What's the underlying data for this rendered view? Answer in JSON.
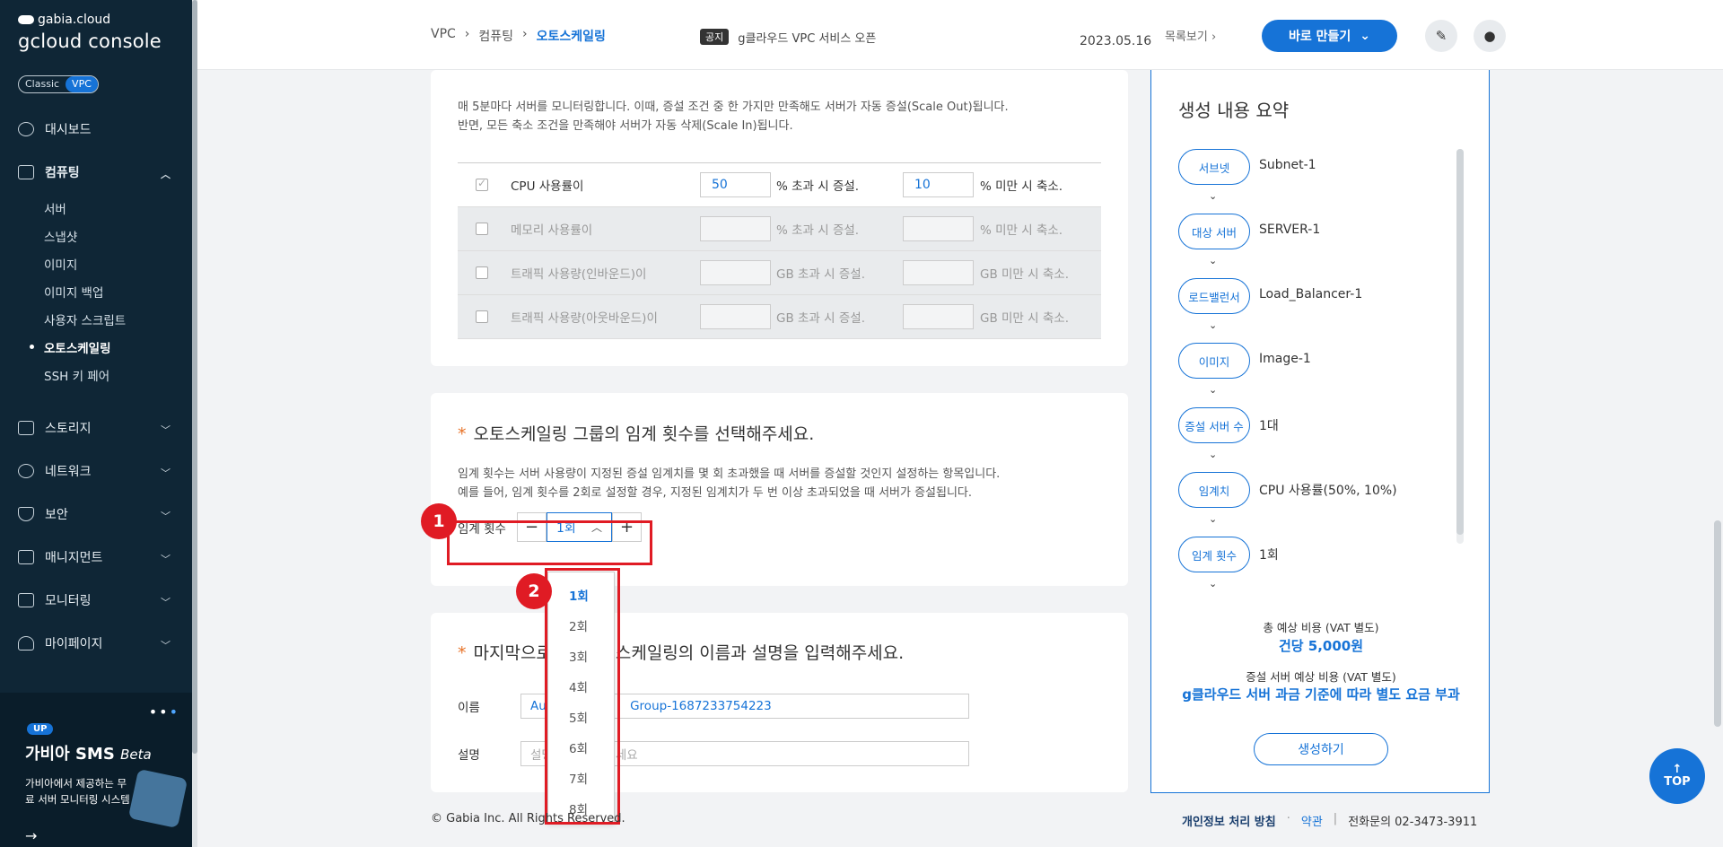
{
  "brand": {
    "small": "gabia.cloud",
    "big": "gcloud console"
  },
  "toggle": {
    "classic": "Classic",
    "vpc": "VPC"
  },
  "nav": {
    "dashboard": "대시보드",
    "computing": "컴퓨팅",
    "computing_sub": [
      "서버",
      "스냅샷",
      "이미지",
      "이미지 백업",
      "사용자 스크립트",
      "오토스케일링",
      "SSH 키 페어"
    ],
    "storage": "스토리지",
    "network": "네트워크",
    "security": "보안",
    "management": "매니지먼트",
    "monitoring": "모니터링",
    "mypage": "마이페이지"
  },
  "promo": {
    "badge": "UP",
    "title": "가비아 SMS",
    "title_beta": "Beta",
    "desc": "가비아에서 제공하는 무료 서버 모니터링 시스템",
    "arrow": "→"
  },
  "breadcrumb": {
    "vpc": "VPC",
    "computing": "컴퓨팅",
    "current": "오토스케일링",
    "sep": "›"
  },
  "notice": {
    "tag": "공지",
    "text": "g클라우드 VPC 서비스 오픈",
    "date": "2023.05.16",
    "more": "목록보기 ›"
  },
  "header": {
    "create_button": "바로 만들기"
  },
  "conditions": {
    "intro_line1": "매 5분마다 서버를 모니터링합니다. 이때, 증설 조건 중 한 가지만 만족해도 서버가 자동 증설(Scale Out)됩니다.",
    "intro_line2": "반면, 모든 축소 조건을 만족해야 서버가 자동 삭제(Scale In)됩니다.",
    "rows": [
      {
        "label": "CPU 사용률이",
        "up_value": "50",
        "up_unit": "% 초과 시 증설.",
        "down_value": "10",
        "down_unit": "% 미만 시 축소."
      },
      {
        "label": "메모리 사용률이",
        "up_value": "",
        "up_unit": "% 초과 시 증설.",
        "down_value": "",
        "down_unit": "% 미만 시 축소."
      },
      {
        "label": "트래픽 사용량(인바운드)이",
        "up_value": "",
        "up_unit": "GB 초과 시 증설.",
        "down_value": "",
        "down_unit": "GB 미만 시 축소."
      },
      {
        "label": "트래픽 사용량(아웃바운드)이",
        "up_value": "",
        "up_unit": "GB 초과 시 증설.",
        "down_value": "",
        "down_unit": "GB 미만 시 축소."
      }
    ]
  },
  "threshold": {
    "title": "오토스케일링 그룹의 임계 횟수를 선택해주세요.",
    "desc_line1": "임계 횟수는 서버 사용량이 지정된 증설 임계치를 몇 회 초과했을 때 서버를 증설할 것인지 설정하는 항목입니다.",
    "desc_line2": "예를 들어, 임계 횟수를 2회로 설정할 경우, 지정된 임계치가 두 번 이상 초과되었을 때 서버가 증설됩니다.",
    "label": "임계 횟수",
    "minus": "−",
    "plus": "+",
    "value": "1회",
    "options": [
      "1회",
      "2회",
      "3회",
      "4회",
      "5회",
      "6회",
      "7회",
      "8회"
    ],
    "annotation_1": "1",
    "annotation_2": "2"
  },
  "naming": {
    "title_pre": "마지막으로",
    "title_post": "오토스케일링의 이름과 설명을 입력해주세요.",
    "name_label": "이름",
    "name_value_pre": "Aut",
    "name_value_post": "Group-1687233754223",
    "desc_label": "설명",
    "desc_placeholder_pre": "설명",
    "desc_placeholder_post": "세요"
  },
  "footer": {
    "copyright": "© Gabia Inc. All Rights Reserved.",
    "privacy": "개인정보 처리 방침",
    "dot": "·",
    "terms": "약관",
    "bar": "|",
    "phone": "전화문의  02-3473-3911"
  },
  "summary": {
    "title": "생성 내용 요약",
    "items": [
      {
        "label": "서브넷",
        "value": "Subnet-1"
      },
      {
        "label": "대상 서버",
        "value": "SERVER-1"
      },
      {
        "label": "로드밸런서",
        "value": "Load_Balancer-1"
      },
      {
        "label": "이미지",
        "value": "Image-1"
      },
      {
        "label": "증설 서버 수",
        "value": "1대"
      },
      {
        "label": "임계치",
        "value": "CPU 사용률(50%, 10%)"
      },
      {
        "label": "임계 횟수",
        "value": "1회"
      }
    ],
    "total_label": "총 예상 비용 (VAT 별도)",
    "total_value": "건당 5,000원",
    "server_label": "증설 서버 예상 비용 (VAT 별도)",
    "server_value": "g클라우드 서버 과금 기준에 따라 별도 요금 부과",
    "create_button": "생성하기"
  },
  "top_button": {
    "arrow": "↑",
    "label": "TOP"
  },
  "colors": {
    "accent": "#1673d7",
    "sidebar": "#0f2636",
    "annotation": "#e01b24",
    "required": "#e8742a"
  }
}
